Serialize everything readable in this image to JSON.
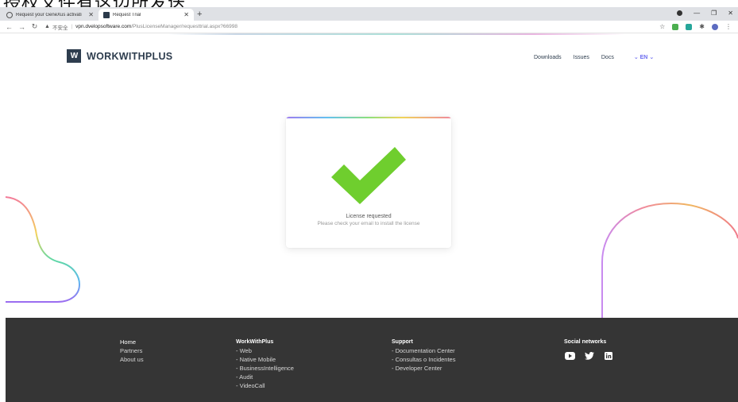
{
  "overlay": {
    "caption": "授权文件有这边所发送"
  },
  "browser": {
    "tabs": [
      {
        "title": "Request your GeneXus activati"
      },
      {
        "title": "Request Trial"
      }
    ],
    "new_tab": "+",
    "address": {
      "insecure_label": "不安全",
      "host": "vpn.dvelopsoftware.com",
      "path": "/PlusLicenseManager/requesttrial.aspx?66998"
    }
  },
  "site": {
    "logo_mark": "W",
    "logo_text": "WORKWITHPLUS",
    "nav": [
      "Downloads",
      "Issues",
      "Docs"
    ],
    "language": "EN"
  },
  "card": {
    "title": "License requested",
    "subtitle": "Please check your email to install the license",
    "check_color": "#6fce2e"
  },
  "footer": {
    "col1": [
      "Home",
      "Partners",
      "About us"
    ],
    "col2": {
      "heading": "WorkWithPlus",
      "items": [
        "- Web",
        "- Native Mobile",
        "- BusinessIntelligence",
        "- Audit",
        "- VideoCall"
      ]
    },
    "col3": {
      "heading": "Support",
      "items": [
        "- Documentation Center",
        "- Consultas o Incidentes",
        "- Developer Center"
      ]
    },
    "col4": {
      "heading": "Social networks"
    },
    "social": [
      "youtube-icon",
      "twitter-icon",
      "linkedin-icon"
    ]
  }
}
